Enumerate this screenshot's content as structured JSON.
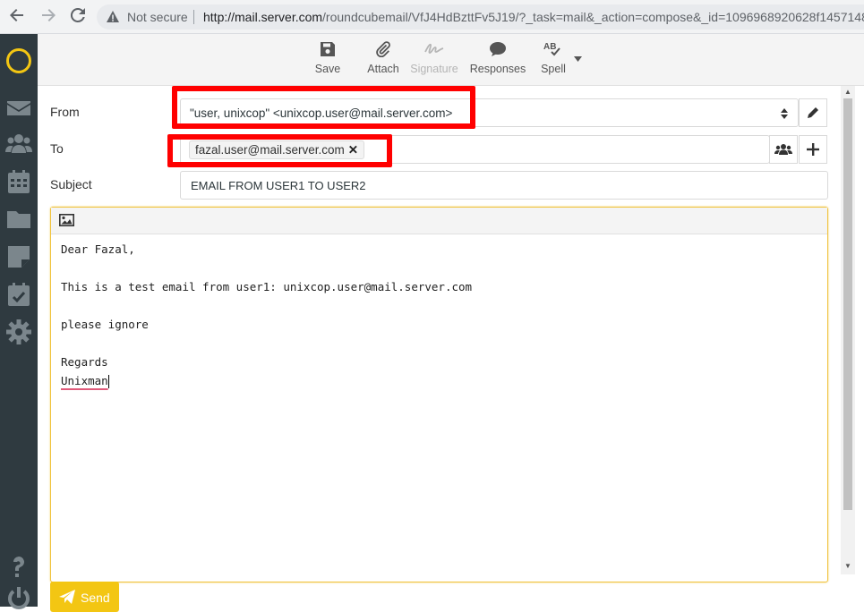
{
  "browser": {
    "security_label": "Not secure",
    "url_host": "http://mail.server.com",
    "url_path": "/roundcubemail/VfJ4HdBzttFv5J19/?_task=mail&_action=compose&_id=1096968920628f1457148"
  },
  "toolbar": {
    "save": "Save",
    "attach": "Attach",
    "signature": "Signature",
    "responses": "Responses",
    "spell": "Spell"
  },
  "compose": {
    "from_label": "From",
    "from_value": "\"user, unixcop\" <unixcop.user@mail.server.com>",
    "to_label": "To",
    "to_recipient": "fazal.user@mail.server.com",
    "subject_label": "Subject",
    "subject_value": "EMAIL FROM USER1 TO USER2",
    "body_lines": [
      "Dear Fazal,",
      "",
      "This is a test email from user1: unixcop.user@mail.server.com",
      "",
      "please ignore",
      "",
      "Regards",
      "Unixman"
    ]
  },
  "send_label": "Send",
  "colors": {
    "accent": "#f3c613",
    "sidebar": "#2f3a40",
    "highlight": "#ff0000"
  },
  "icons": [
    "back-icon",
    "forward-icon",
    "reload-icon",
    "warning-icon",
    "save-icon",
    "attach-icon",
    "signature-icon",
    "responses-icon",
    "spell-icon",
    "pencil-icon",
    "contacts-icon",
    "plus-icon",
    "image-icon",
    "send-icon"
  ]
}
